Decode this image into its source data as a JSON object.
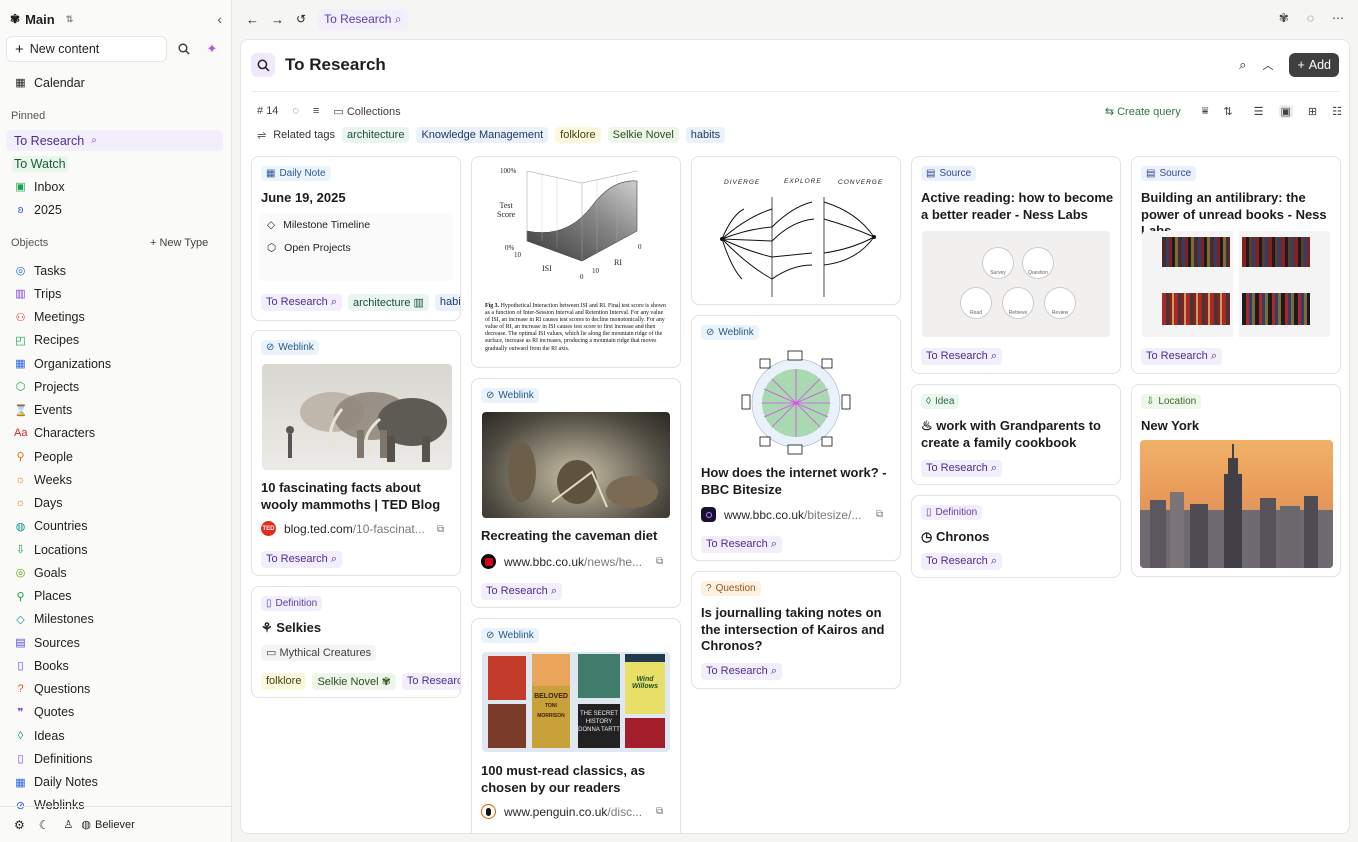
{
  "sidebar": {
    "workspace": "Main",
    "new_content": "New content",
    "pinned_label": "Pinned",
    "pinned": [
      {
        "label": "To Research",
        "icon": "search-icon",
        "color": "#7c3aed"
      },
      {
        "label": "To Watch",
        "icon": "",
        "color": "#16a34a"
      },
      {
        "label": "Inbox",
        "icon": "inbox-icon",
        "color": "#16a34a"
      },
      {
        "label": "2025",
        "icon": "butterfly-icon",
        "color": "#2563eb"
      }
    ],
    "objects_label": "Objects",
    "new_type": "New Type",
    "objects": [
      {
        "label": "Tasks",
        "icon": "circle-check-icon",
        "color": "#2563eb"
      },
      {
        "label": "Trips",
        "icon": "suitcase-icon",
        "color": "#7c3aed"
      },
      {
        "label": "Meetings",
        "icon": "people-icon",
        "color": "#dc2626"
      },
      {
        "label": "Recipes",
        "icon": "chef-icon",
        "color": "#16a34a"
      },
      {
        "label": "Organizations",
        "icon": "building-icon",
        "color": "#2563eb"
      },
      {
        "label": "Projects",
        "icon": "cube-icon",
        "color": "#16a34a"
      },
      {
        "label": "Events",
        "icon": "hourglass-icon",
        "color": "#ea580c"
      },
      {
        "label": "Characters",
        "icon": "characters-icon",
        "color": "#dc2626"
      },
      {
        "label": "People",
        "icon": "person-icon",
        "color": "#d97706"
      },
      {
        "label": "Weeks",
        "icon": "sun-icon",
        "color": "#d97706"
      },
      {
        "label": "Days",
        "icon": "sun-icon",
        "color": "#d97706"
      },
      {
        "label": "Countries",
        "icon": "globe-icon",
        "color": "#0d9488"
      },
      {
        "label": "Locations",
        "icon": "location-icon",
        "color": "#16a34a"
      },
      {
        "label": "Goals",
        "icon": "target-icon",
        "color": "#65a30d"
      },
      {
        "label": "Places",
        "icon": "pin-icon",
        "color": "#16a34a"
      },
      {
        "label": "Milestones",
        "icon": "diamond-icon",
        "color": "#0d9488"
      },
      {
        "label": "Sources",
        "icon": "source-icon",
        "color": "#4f46e5"
      },
      {
        "label": "Books",
        "icon": "book-icon",
        "color": "#4f46e5"
      },
      {
        "label": "Questions",
        "icon": "question-icon",
        "color": "#ea580c"
      },
      {
        "label": "Quotes",
        "icon": "quote-icon",
        "color": "#7c3aed"
      },
      {
        "label": "Ideas",
        "icon": "bulb-icon",
        "color": "#0d9488"
      },
      {
        "label": "Definitions",
        "icon": "bookmark-icon",
        "color": "#7c3aed"
      },
      {
        "label": "Daily Notes",
        "icon": "calendar-icon",
        "color": "#2563eb"
      },
      {
        "label": "Weblinks",
        "icon": "link-icon",
        "color": "#2563eb"
      }
    ],
    "calendar": "Calendar",
    "user": "Believer"
  },
  "topbar": {
    "breadcrumb": "To Research"
  },
  "page": {
    "title": "To Research",
    "add": "Add",
    "count": "14",
    "collections": "Collections",
    "create_query": "Create query",
    "related_tags_label": "Related tags",
    "related_tags": [
      "architecture",
      "Knowledge Management",
      "folklore",
      "Selkie Novel",
      "habits"
    ]
  },
  "cards": {
    "daily": {
      "badge": "Daily Note",
      "title": "June 19, 2025",
      "items": [
        "Milestone Timeline",
        "Open Projects"
      ],
      "tags": [
        "To Research",
        "architecture",
        "habits"
      ]
    },
    "mammoth": {
      "badge": "Weblink",
      "title": "10 fascinating facts about wooly mammoths | TED Blog",
      "domain": "blog.ted.com",
      "path": "/10-fascinat...",
      "favicon": "TED",
      "tag": "To Research"
    },
    "selkies": {
      "badge": "Definition",
      "title": "Selkies",
      "collection": "Mythical Creatures",
      "tags": [
        "folklore",
        "Selkie Novel",
        "To Research"
      ]
    },
    "fig": {
      "axis_top": "100%",
      "axis_mid": "0%",
      "zlabel": "Test\nScore",
      "xlabel": "ISI",
      "ylabel": "RI",
      "ticks": [
        "10",
        "0",
        "10",
        "0"
      ],
      "caption_head": "Fig 3.",
      "caption": "Hypothetical Interaction between ISI and RI. Final test score is shown as a function of Inter-Session Interval and Retention Interval. For any value of ISI, an increase in RI causes test scores to decline monotonically. For any value of RI, an increase in ISI causes test score to first increase and then decrease. The optimal ISI values, which lie along the mountain ridge of the surface, increase as RI increases, producing a mountain ridge that moves gradually outward from the RI axis."
    },
    "caveman": {
      "badge": "Weblink",
      "title": "Recreating the caveman diet",
      "domain": "www.bbc.co.uk",
      "path": "/news/he...",
      "tag": "To Research"
    },
    "classics": {
      "badge": "Weblink",
      "title": "100 must-read classics, as chosen by our readers",
      "domain": "www.penguin.co.uk",
      "path": "/disc...",
      "covers": [
        "BELOVED",
        "TONI MORRISON",
        "THE SECRET HISTORY",
        "DONNA TARTT",
        "Wind Willows"
      ]
    },
    "diverge": {
      "labels": [
        "DIVERGE",
        "EXPLORE",
        "CONVERGE"
      ]
    },
    "internet": {
      "badge": "Weblink",
      "title": "How does the internet work? - BBC Bitesize",
      "domain": "www.bbc.co.uk",
      "path": "/bitesize/...",
      "tag": "To Research"
    },
    "journal": {
      "badge": "Question",
      "title": "Is journalling taking notes on the intersection of Kairos and Chronos?",
      "tag": "To Research"
    },
    "active": {
      "badge": "Source",
      "title": "Active reading: how to become a better reader - Ness Labs",
      "tag": "To Research",
      "steps": [
        "Survey",
        "Question",
        "Read",
        "Retrieve",
        "Review"
      ]
    },
    "grandparents": {
      "badge": "Idea",
      "title": "work with Grandparents to create a family cookbook",
      "tag": "To Research"
    },
    "chronos": {
      "badge": "Definition",
      "title": "Chronos",
      "tag": "To Research"
    },
    "antilibrary": {
      "badge": "Source",
      "title": "Building an antilibrary: the power of unread books - Ness Labs",
      "tag": "To Research"
    },
    "newyork": {
      "badge": "Location",
      "title": "New York"
    }
  }
}
